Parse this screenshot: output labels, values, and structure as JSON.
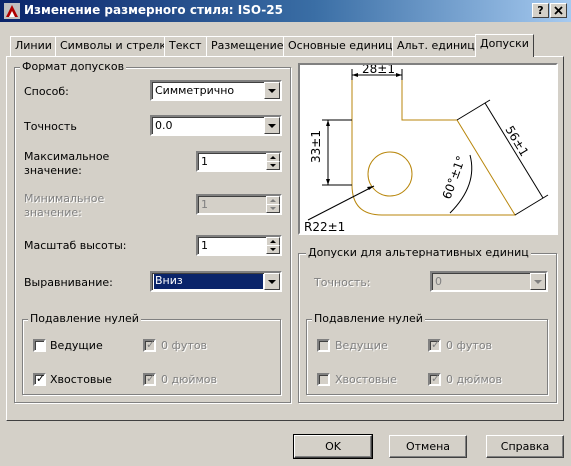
{
  "window": {
    "title": "Изменение размерного стиля: ISO-25",
    "help_btn": "?",
    "close_btn": "X"
  },
  "tabs": [
    {
      "label": "Линии"
    },
    {
      "label": "Символы и стрелки"
    },
    {
      "label": "Текст"
    },
    {
      "label": "Размещение"
    },
    {
      "label": "Основные единицы"
    },
    {
      "label": "Альт. единицы"
    },
    {
      "label": "Допуски",
      "active": true
    }
  ],
  "tolerance_format": {
    "group_title": "Формат допусков",
    "method_label": "Способ:",
    "method_value": "Симметрично",
    "precision_label": "Точность",
    "precision_value": "0.0",
    "upper_label_1": "Максимальное",
    "upper_label_2": "значение:",
    "upper_value": "1",
    "lower_label_1": "Минимальное",
    "lower_label_2": "значение:",
    "lower_value": "1",
    "scale_label": "Масштаб высоты:",
    "scale_value": "1",
    "position_label": "Выравнивание:",
    "position_value": "Вниз"
  },
  "zero_suppression": {
    "group_title": "Подавление нулей",
    "leading_label": "Ведущие",
    "leading_checked": false,
    "feet_label": "0 футов",
    "feet_checked": true,
    "trailing_label": "Хвостовые",
    "trailing_checked": true,
    "inches_label": "0 дюймов",
    "inches_checked": true
  },
  "preview": {
    "dim_top": "28±1",
    "dim_left": "33±1",
    "dim_diag": "56±1",
    "dim_angle": "60°±1°",
    "dim_radius": "R22±1"
  },
  "alt_tolerance": {
    "group_title": "Допуски для альтернативных единиц",
    "precision_label": "Точность:",
    "precision_value": "0"
  },
  "alt_zero_suppression": {
    "group_title": "Подавление нулей",
    "leading_label": "Ведущие",
    "leading_checked": false,
    "feet_label": "0 футов",
    "feet_checked": true,
    "trailing_label": "Хвостовые",
    "trailing_checked": false,
    "inches_label": "0 дюймов",
    "inches_checked": true
  },
  "buttons": {
    "ok": "OK",
    "cancel": "Отмена",
    "help": "Справка"
  },
  "colors": {
    "title_active": "#0a246a",
    "face": "#d4d0c8",
    "preview_geometry": "#b8860b"
  }
}
